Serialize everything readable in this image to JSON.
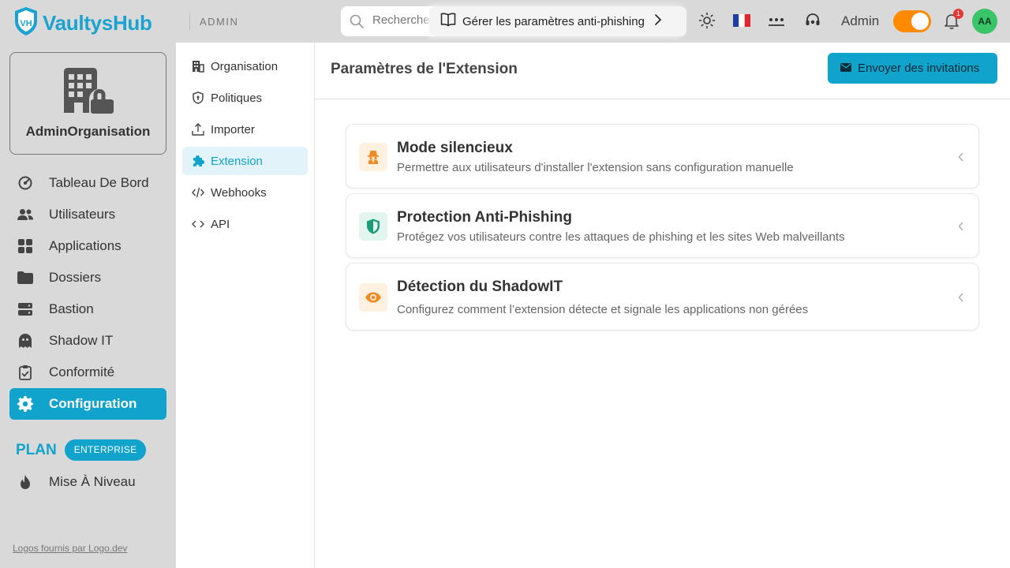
{
  "header": {
    "brand": "VaultysHub",
    "logo_letters": "VH",
    "section_tag": "ADMIN",
    "search_placeholder": "Recherche",
    "guide_label": "Gérer les paramètres anti-phishing",
    "mode_label": "Admin",
    "notification_count": "1",
    "avatar_initials": "AA",
    "colors": {
      "accent": "#10a3cc",
      "toggle": "#ff8a00",
      "avatar": "#39c46a",
      "badge": "#e53935"
    }
  },
  "sidebar": {
    "org_name": "AdminOrganisation",
    "items": [
      {
        "label": "Tableau De Bord",
        "icon": "dashboard-icon"
      },
      {
        "label": "Utilisateurs",
        "icon": "users-icon"
      },
      {
        "label": "Applications",
        "icon": "apps-grid-icon"
      },
      {
        "label": "Dossiers",
        "icon": "folder-icon"
      },
      {
        "label": "Bastion",
        "icon": "server-icon"
      },
      {
        "label": "Shadow IT",
        "icon": "ghost-icon"
      },
      {
        "label": "Conformité",
        "icon": "clipboard-icon"
      },
      {
        "label": "Configuration",
        "icon": "gear-icon",
        "active": true
      }
    ],
    "plan_label": "PLAN",
    "plan_badge": "ENTERPRISE",
    "upgrade_label": "Mise À Niveau",
    "footer_link": "Logos fournis par Logo.dev"
  },
  "subnav": {
    "items": [
      {
        "label": "Organisation",
        "icon": "building-icon"
      },
      {
        "label": "Politiques",
        "icon": "shield-icon"
      },
      {
        "label": "Importer",
        "icon": "upload-icon"
      },
      {
        "label": "Extension",
        "icon": "puzzle-icon",
        "active": true
      },
      {
        "label": "Webhooks",
        "icon": "code-slash-icon"
      },
      {
        "label": "API",
        "icon": "code-icon"
      }
    ]
  },
  "main": {
    "title": "Paramètres de l'Extension",
    "invite_button": "Envoyer des invitations",
    "cards": [
      {
        "title": "Mode silencieux",
        "description": "Permettre aux utilisateurs d'installer l'extension sans configuration manuelle",
        "icon": "incognito-icon",
        "icon_bg": "#fff1e0",
        "icon_color": "#f08a24"
      },
      {
        "title": "Protection Anti-Phishing",
        "description": "Protégez vos utilisateurs contre les attaques de phishing et les sites Web malveillants",
        "icon": "shield-check-icon",
        "icon_bg": "#e3f5ef",
        "icon_color": "#1f9d7a"
      },
      {
        "title": "Détection du ShadowIT",
        "description": "Configurez comment l’extension détecte et signale les applications non gérées",
        "icon": "eye-icon",
        "icon_bg": "#fff1e0",
        "icon_color": "#f08a24"
      }
    ]
  }
}
